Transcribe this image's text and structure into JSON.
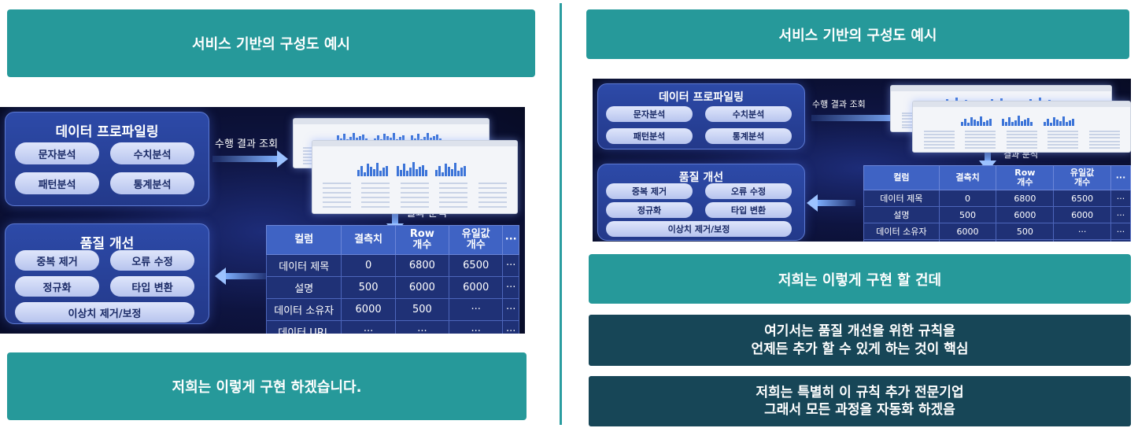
{
  "left": {
    "title": "서비스 기반의 구성도 예시",
    "footer": "저희는 이렇게 구현 하겠습니다."
  },
  "right": {
    "title": "서비스 기반의 구성도 예시",
    "banner": "저희는 이렇게 구현 할 건데",
    "note1": {
      "line1": "여기서는 품질 개선을 위한 규칙을",
      "line2": "언제든 추가 할 수 있게 하는 것이 핵심"
    },
    "note2": {
      "line1": "저희는 특별히 이 규칙 추가 전문기업",
      "line2": "그래서 모든 과정을 자동화 하겠음"
    }
  },
  "diagram": {
    "profiling": {
      "title": "데이터 프로파일링",
      "items": [
        "문자분석",
        "수치분석",
        "패턴분석",
        "통계분석"
      ]
    },
    "quality": {
      "title": "품질 개선",
      "items": [
        "중복 제거",
        "오류 수정",
        "정규화",
        "타입 변환",
        "이상치 제거/보정"
      ]
    },
    "arrows": {
      "query": "수행 결과 조회",
      "analysis": "결과 분석"
    },
    "table": {
      "headers": [
        "컬럼",
        "결측치",
        "Row\n개수",
        "유일값\n개수",
        "···"
      ],
      "rows": [
        [
          "데이터 제목",
          "0",
          "6800",
          "6500",
          "···"
        ],
        [
          "설명",
          "500",
          "6000",
          "6000",
          "···"
        ],
        [
          "데이터 소유자",
          "6000",
          "500",
          "···",
          "···"
        ],
        [
          "데이터 URL",
          "···",
          "···",
          "···",
          "···"
        ]
      ]
    }
  },
  "colors": {
    "teal": "#26999a",
    "navy": "#174657",
    "diagram_bg": "#0e1440"
  }
}
